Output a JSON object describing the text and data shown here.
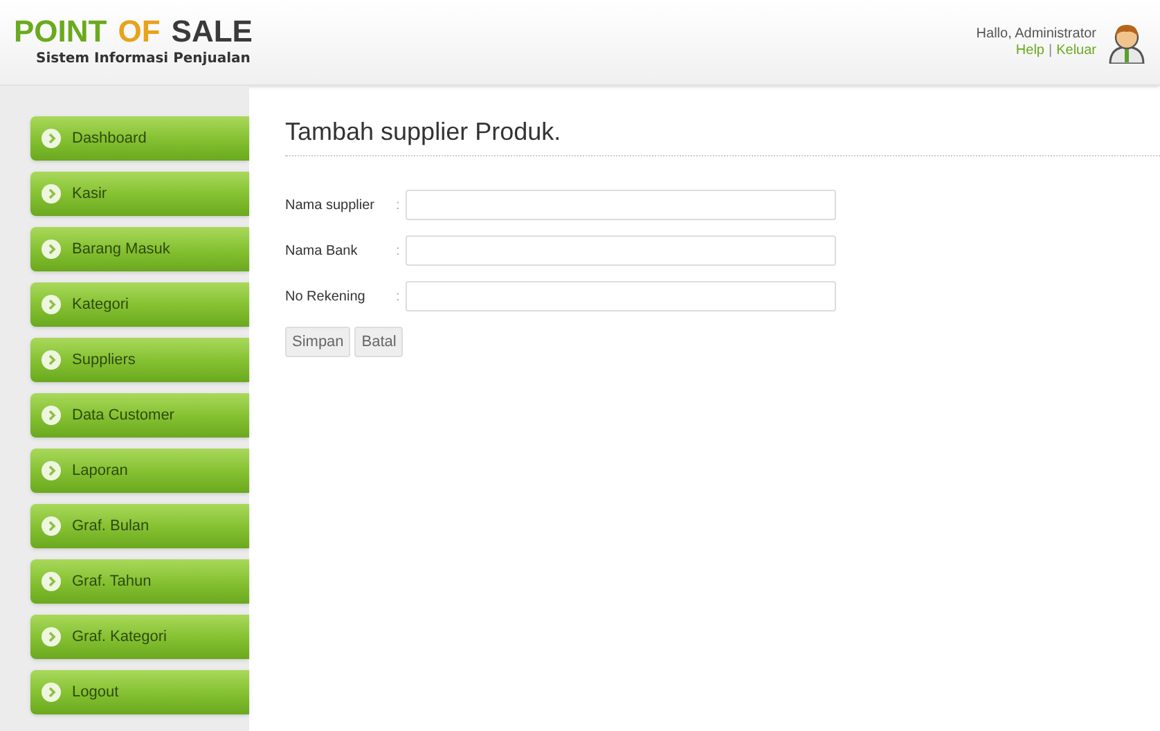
{
  "logo": {
    "words": [
      {
        "text": "POINT",
        "color": "#6aaa1e"
      },
      {
        "text": "OF",
        "color": "#e8a21c"
      },
      {
        "text": "SALE",
        "color": "#3a3a3a"
      }
    ],
    "subtitle": "Sistem Informasi Penjualan"
  },
  "user": {
    "greeting": "Hallo, Administrator",
    "links": [
      "Help",
      "Keluar"
    ],
    "link_separator": "|"
  },
  "sidebar": {
    "items": [
      {
        "label": "Dashboard"
      },
      {
        "label": "Kasir"
      },
      {
        "label": "Barang Masuk"
      },
      {
        "label": "Kategori"
      },
      {
        "label": "Suppliers"
      },
      {
        "label": "Data Customer"
      },
      {
        "label": "Laporan"
      },
      {
        "label": "Graf. Bulan"
      },
      {
        "label": "Graf. Tahun"
      },
      {
        "label": "Graf. Kategori"
      },
      {
        "label": "Logout"
      }
    ]
  },
  "form": {
    "title": "Tambah supplier Produk.",
    "fields": [
      {
        "label": "Nama supplier",
        "separator": ":"
      },
      {
        "label": "Nama Bank",
        "separator": ":"
      },
      {
        "label": "No Rekening",
        "separator": ":"
      }
    ],
    "buttons": [
      "Simpan",
      "Batal"
    ]
  }
}
